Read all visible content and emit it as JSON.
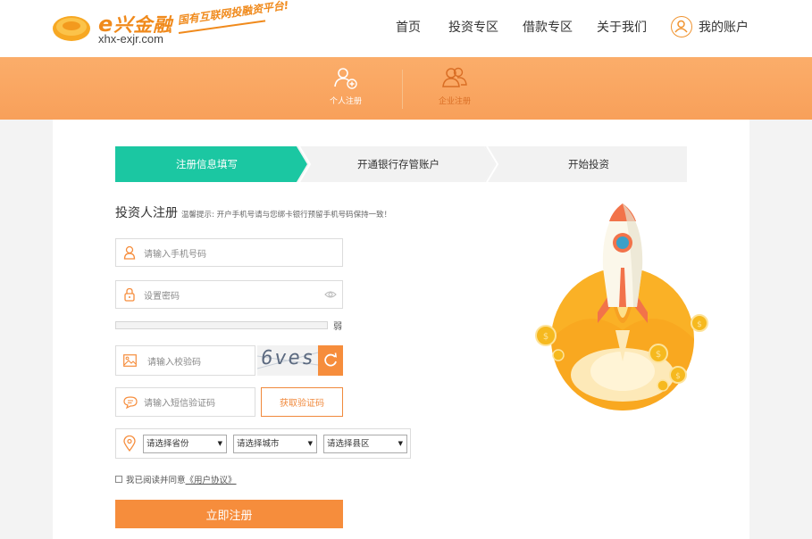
{
  "brand": {
    "name_prefix": "e",
    "name": "兴金融",
    "url": "xhx-exjr.com",
    "slogan": "国有互联网投融资平台!",
    "accent_color": "#f68d3c",
    "teal_color": "#1bc7a2"
  },
  "nav": {
    "items": [
      {
        "label": "首页"
      },
      {
        "label": "投资专区"
      },
      {
        "label": "借款专区"
      },
      {
        "label": "关于我们"
      }
    ],
    "account_icon": "user-circle-icon",
    "account_label": "我的账户"
  },
  "tabs": [
    {
      "label": "个人注册",
      "icon": "add-user-icon",
      "active": true
    },
    {
      "label": "企业注册",
      "icon": "group-users-icon",
      "active": false
    }
  ],
  "steps": [
    {
      "label": "注册信息填写",
      "active": true
    },
    {
      "label": "开通银行存管账户",
      "active": false
    },
    {
      "label": "开始投资",
      "active": false
    }
  ],
  "form": {
    "title": "投资人注册",
    "hint": "温馨提示: 开户手机号请与您绑卡银行预留手机号码保持一致！",
    "phone_placeholder": "请输入手机号码",
    "password_placeholder": "设置密码",
    "password_strength_label": "弱",
    "password_strength_value": 0.0,
    "captcha_placeholder": "请输入校验码",
    "captcha_image_text": "6ves",
    "sms_placeholder": "请输入短信验证码",
    "sms_button": "获取验证码",
    "province": "请选择省份",
    "city": "请选择城市",
    "county": "请选择县区",
    "agree_text": "我已阅读并同意",
    "agree_link": "《用户协议》",
    "submit": "立即注册"
  }
}
